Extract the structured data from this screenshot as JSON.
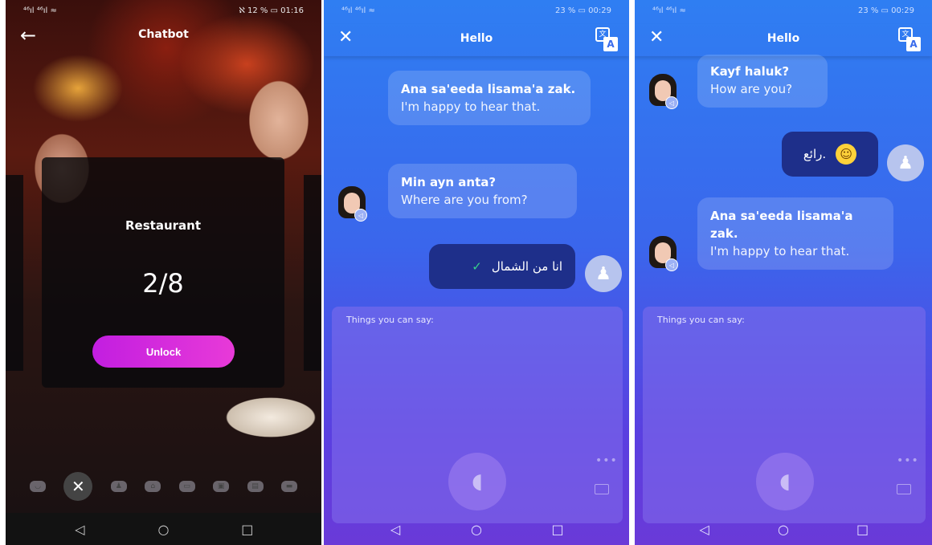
{
  "screen1": {
    "status_left": "⁴⁶ıl ⁴⁶ıl ≈",
    "status_right": "ℵ 12 % ▭ 01:16",
    "title": "Chatbot",
    "back_icon": "arrow-left",
    "card": {
      "topic": "Restaurant",
      "progress": "2/8",
      "unlock_label": "Unlock"
    },
    "topic_icons": [
      "chat-icon",
      "fork-knife-icon",
      "person-icon",
      "house-icon",
      "card-icon",
      "bag-icon",
      "folder-icon",
      "car-icon"
    ]
  },
  "screen2": {
    "status_left": "⁴⁶ıl ⁴⁶ıl ≈",
    "status_right": "23 % ▭ 00:29",
    "title": "Hello",
    "messages": [
      {
        "from": "bot",
        "transliteration": "Ana sa'eeda lisama'a zak.",
        "translation": "I'm happy to hear that."
      },
      {
        "from": "bot",
        "transliteration": "Min ayn anta?",
        "translation": "Where are you from?"
      },
      {
        "from": "user",
        "text": "انا من الشمال"
      }
    ],
    "suggestions_label": "Things you can say:"
  },
  "screen3": {
    "status_left": "⁴⁶ıl ⁴⁶ıl ≈",
    "status_right": "23 % ▭ 00:29",
    "title": "Hello",
    "messages": [
      {
        "from": "bot",
        "transliteration": "Kayf haluk?",
        "translation": "How are you?"
      },
      {
        "from": "user",
        "text": "رائع."
      },
      {
        "from": "bot",
        "transliteration": "Ana sa'eeda lisama'a zak.",
        "translation": "I'm happy to hear that."
      }
    ],
    "suggestions_label": "Things you can say:"
  },
  "colors": {
    "accent_unlock": "#d42ae0",
    "chat_blue": "#3a66ec",
    "user_bubble": "#1e2f8a"
  }
}
